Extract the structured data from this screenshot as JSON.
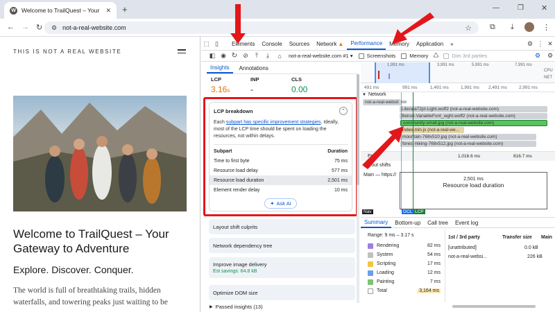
{
  "browser": {
    "tab_title": "Welcome to TrailQuest – Your G",
    "new_tab": "+",
    "url": "not-a-real-website.com"
  },
  "page": {
    "brand": "THIS IS NOT A REAL WEBSITE",
    "headline": "Welcome to TrailQuest – Your Gateway to Adventure",
    "subheadline": "Explore. Discover. Conquer.",
    "body": "The world is full of breathtaking trails, hidden waterfalls, and towering peaks just waiting to be"
  },
  "devtools": {
    "tabs": [
      "Elements",
      "Console",
      "Sources",
      "Network",
      "Performance",
      "Memory",
      "Application"
    ],
    "more": "»",
    "recording": "not-a-real-website.com #1",
    "screenshots_label": "Screenshots",
    "memory_label": "Memory",
    "dim3p_label": "Dim 3rd parties",
    "side_tabs": [
      "Insights",
      "Annotations"
    ],
    "metrics": [
      {
        "label": "LCP",
        "value": "3.16",
        "unit": "s",
        "color": "#e8710a"
      },
      {
        "label": "INP",
        "value": "-",
        "unit": "",
        "color": "#1f1f1f"
      },
      {
        "label": "CLS",
        "value": "0.00",
        "unit": "",
        "color": "#0d904f"
      }
    ],
    "lcp": {
      "title": "LCP breakdown",
      "desc_pre": "Each ",
      "desc_link": "subpart has specific improvement strategies",
      "desc_post": ". Ideally, most of the LCP time should be spent on loading the resources, not within delays.",
      "col_subpart": "Subpart",
      "col_duration": "Duration",
      "rows": [
        {
          "name": "Time to first byte",
          "value": "75 ms"
        },
        {
          "name": "Resource load delay",
          "value": "577 ms"
        },
        {
          "name": "Resource load duration",
          "value": "2,501 ms"
        },
        {
          "name": "Element render delay",
          "value": "10 ms"
        }
      ],
      "ask_ai": "Ask AI"
    },
    "insights": [
      {
        "title": "Layout shift culprits",
        "sub": ""
      },
      {
        "title": "Network dependency tree",
        "sub": ""
      },
      {
        "title": "Improve image delivery",
        "sub": "Est savings: 64.8 kB"
      },
      {
        "title": "Optimize DOM size",
        "sub": ""
      }
    ],
    "passed": "Passed insights (13)",
    "overview_ticks": [
      "1,991 ms",
      "3,991 ms",
      "5,991 ms",
      "7,991 ms"
    ],
    "overview_side": [
      "CPU",
      "NET"
    ],
    "timeline_ticks": [
      "491 ms",
      "991 ms",
      "1,491 ms",
      "1,991 ms",
      "2,491 ms",
      "2,991 ms"
    ],
    "network_label": "Network",
    "network_doc": "not-a-real-websit",
    "requests": [
      "Literata72pt-Light.woff2 (not-a-real-website.com)",
      "Beiruti-VariableFont_wght.woff2 (not-a-real-website.com)",
      "community-small.jpg (not-a-real-website.com)",
      "index.min.js (not-a-real-we...",
      "mountain-768x510.jpg (not-a-real-website.com)",
      "forest-hiking-768x512.jpg (not-a-real-website.com)"
    ],
    "frames_label": "Fra",
    "frame_ticks": [
      "1,016.6 ms",
      "816.7 ms"
    ],
    "layout_shifts": "Layout shifts",
    "main_label": "Main — https://",
    "overlay_value": "2,501 ms",
    "overlay_label": "Resource load duration",
    "markers": [
      "Nav",
      "DCL",
      "LCP"
    ],
    "bottom_tabs": [
      "Summary",
      "Bottom-up",
      "Call tree",
      "Event log"
    ],
    "range": "Range: 9 ms – 3.17 s",
    "summary": [
      {
        "name": "Rendering",
        "value": "82 ms",
        "color": "#9b7fe6"
      },
      {
        "name": "System",
        "value": "54 ms",
        "color": "#c0c0c0"
      },
      {
        "name": "Scripting",
        "value": "17 ms",
        "color": "#f4c542"
      },
      {
        "name": "Loading",
        "value": "12 ms",
        "color": "#6b9ef0"
      },
      {
        "name": "Painting",
        "value": "7 ms",
        "color": "#7cc470"
      },
      {
        "name": "Total",
        "value": "3,164 ms",
        "color": "#ffffff"
      }
    ],
    "party_headers": [
      "1st / 3rd party",
      "Transfer size",
      "Main"
    ],
    "party_rows": [
      {
        "name": "[unattributed]",
        "size": "0.0 kB"
      },
      {
        "name": "not-a-real-websi...",
        "size": "226 kB"
      }
    ]
  }
}
